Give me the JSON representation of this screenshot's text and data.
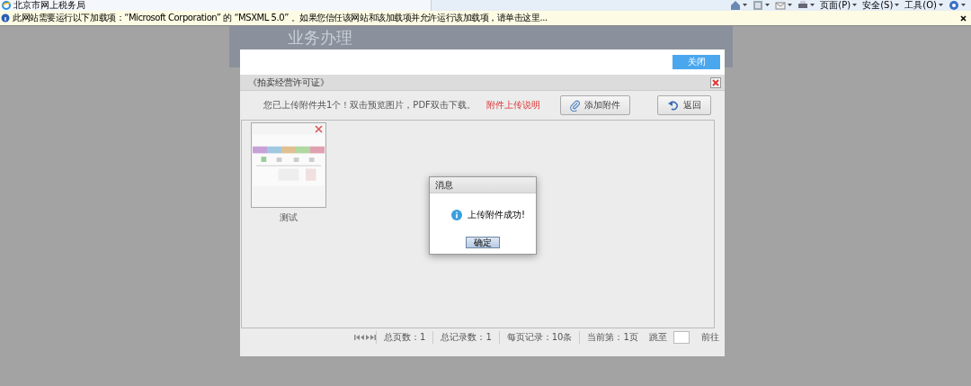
{
  "browser": {
    "tab_title": "北京市网上税务局",
    "toolbar": [
      {
        "kind": "home"
      },
      {
        "kind": "feed"
      },
      {
        "kind": "mail"
      },
      {
        "kind": "print"
      },
      {
        "kind": "menu",
        "label": "页面(P)"
      },
      {
        "kind": "menu",
        "label": "安全(S)"
      },
      {
        "kind": "menu",
        "label": "工具(O)"
      },
      {
        "kind": "help"
      }
    ]
  },
  "info_bar": {
    "text": "此网站需要运行以下加载项：“Microsoft Corporation” 的 “MSXML 5.0” 。如果您信任该网站和该加载项并允许运行该加载项，请单击这里..."
  },
  "background_page": {
    "title": "业务办理"
  },
  "modal": {
    "close_button": "关闭",
    "title": "《拍卖经营许可证》",
    "summary": "您已上传附件共1个！双击预览图片，PDF双击下载。",
    "help_link": "附件上传说明",
    "buttons": [
      {
        "kind": "attach",
        "label": "添加附件"
      },
      {
        "kind": "back",
        "label": "返回"
      }
    ],
    "attachments": [
      {
        "name": "测试",
        "kind": "picture"
      }
    ],
    "pager": {
      "total_pages": "总页数：1",
      "total_records": "总记录数：1",
      "per_page": "每页记录：10条",
      "current": "当前第：1页",
      "jump_label": "跳至",
      "go": "前往"
    }
  },
  "message": {
    "title": "消息",
    "text": "上传附件成功!",
    "ok": "确定"
  }
}
